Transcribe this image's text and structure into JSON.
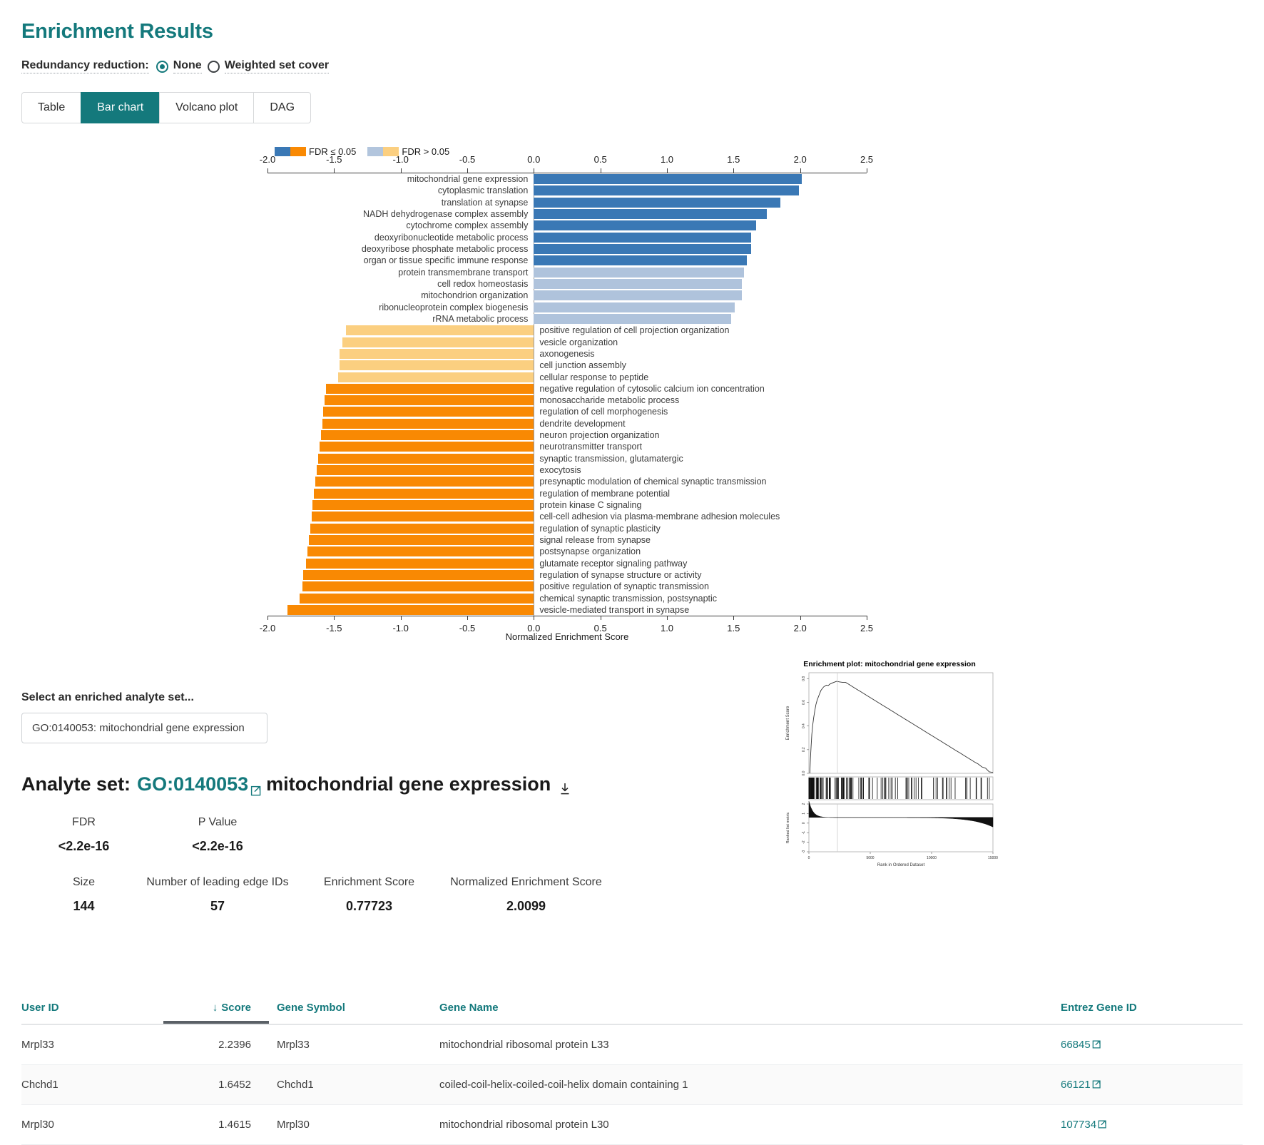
{
  "header": {
    "title": "Enrichment Results"
  },
  "redundancy": {
    "label": "Redundancy reduction:",
    "options": [
      {
        "label": "None",
        "selected": true
      },
      {
        "label": "Weighted set cover",
        "selected": false
      }
    ]
  },
  "tabs": [
    {
      "label": "Table",
      "active": false
    },
    {
      "label": "Bar chart",
      "active": true
    },
    {
      "label": "Volcano plot",
      "active": false
    },
    {
      "label": "DAG",
      "active": false
    }
  ],
  "chart_data": {
    "type": "bar",
    "orientation": "horizontal",
    "title": "",
    "xlabel": "Normalized Enrichment Score",
    "ylabel": "",
    "xlim": [
      -2.0,
      2.5
    ],
    "xticks": [
      -2.0,
      -1.5,
      -1.0,
      -0.5,
      0.0,
      0.5,
      1.0,
      1.5,
      2.0,
      2.5
    ],
    "xticklabels": [
      "-2.0",
      "-1.5",
      "-1.0",
      "-0.5",
      "0.0",
      "0.5",
      "1.0",
      "1.5",
      "2.0",
      "2.5"
    ],
    "grid": false,
    "legend": {
      "position": "top-left",
      "entries": [
        {
          "label": "FDR ≤ 0.05",
          "colors": [
            "#3a78b5",
            "#f98903"
          ]
        },
        {
          "label": "FDR > 0.05",
          "colors": [
            "#b2c5dd",
            "#fbcf80"
          ]
        }
      ]
    },
    "colors": {
      "pos_sig": "#3a78b5",
      "pos_nonsig": "#afc3dc",
      "neg_sig": "#f98903",
      "neg_nonsig": "#fbcf80"
    },
    "categories": [
      "mitochondrial gene expression",
      "cytoplasmic translation",
      "translation at synapse",
      "NADH dehydrogenase complex assembly",
      "cytochrome complex assembly",
      "deoxyribonucleotide metabolic process",
      "deoxyribose phosphate metabolic process",
      "organ or tissue specific immune response",
      "protein transmembrane transport",
      "cell redox homeostasis",
      "mitochondrion organization",
      "ribonucleoprotein complex biogenesis",
      "rRNA metabolic process",
      "positive regulation of cell projection organization",
      "vesicle organization",
      "axonogenesis",
      "cell junction assembly",
      "cellular response to peptide",
      "negative regulation of cytosolic calcium ion concentration",
      "monosaccharide metabolic process",
      "regulation of cell morphogenesis",
      "dendrite development",
      "neuron projection organization",
      "neurotransmitter transport",
      "synaptic transmission, glutamatergic",
      "exocytosis",
      "presynaptic modulation of chemical synaptic transmission",
      "regulation of membrane potential",
      "protein kinase C signaling",
      "cell-cell adhesion via plasma-membrane adhesion molecules",
      "regulation of synaptic plasticity",
      "signal release from synapse",
      "postsynapse organization",
      "glutamate receptor signaling pathway",
      "regulation of synapse structure or activity",
      "positive regulation of synaptic transmission",
      "chemical synaptic transmission, postsynaptic",
      "vesicle-mediated transport in synapse"
    ],
    "values": [
      2.01,
      1.99,
      1.85,
      1.75,
      1.67,
      1.63,
      1.63,
      1.6,
      1.58,
      1.56,
      1.56,
      1.51,
      1.48,
      -1.41,
      -1.44,
      -1.46,
      -1.46,
      -1.47,
      -1.56,
      -1.57,
      -1.58,
      -1.59,
      -1.6,
      -1.61,
      -1.62,
      -1.63,
      -1.64,
      -1.65,
      -1.66,
      -1.67,
      -1.68,
      -1.69,
      -1.7,
      -1.71,
      -1.73,
      -1.74,
      -1.76,
      -1.85
    ],
    "significant": [
      true,
      true,
      true,
      true,
      true,
      true,
      true,
      true,
      false,
      false,
      false,
      false,
      false,
      false,
      false,
      false,
      false,
      false,
      true,
      true,
      true,
      true,
      true,
      true,
      true,
      true,
      true,
      true,
      true,
      true,
      true,
      true,
      true,
      true,
      true,
      true,
      true,
      true
    ]
  },
  "selector": {
    "label": "Select an enriched analyte set...",
    "value": "GO:0140053: mitochondrial gene expression"
  },
  "analyte": {
    "prefix": "Analyte set:",
    "id": "GO:0140053",
    "name": "mitochondrial gene expression",
    "external_link_icon": "external-link-icon",
    "download_icon": "download-icon"
  },
  "stats": {
    "row1": [
      {
        "key": "FDR",
        "value": "<2.2e-16"
      },
      {
        "key": "P Value",
        "value": "<2.2e-16"
      }
    ],
    "row2": [
      {
        "key": "Size",
        "value": "144"
      },
      {
        "key": "Number of leading edge IDs",
        "value": "57"
      },
      {
        "key": "Enrichment Score",
        "value": "0.77723"
      },
      {
        "key": "Normalized Enrichment Score",
        "value": "2.0099"
      }
    ]
  },
  "gsea_plot": {
    "title": "Enrichment plot: mitochondrial gene expression",
    "ylabel_top": "Enrichment Score",
    "ylabel_bottom": "Ranked list metric",
    "xlabel": "Rank in Ordered Dataset",
    "yticks_top": [
      "0.0",
      "0.2",
      "0.4",
      "0.6",
      "0.8"
    ],
    "yticks_bottom": [
      "-3",
      "-2",
      "-1",
      "0",
      "1",
      "2"
    ],
    "xticks": [
      "0",
      "5000",
      "10000",
      "15000"
    ]
  },
  "table": {
    "columns": [
      "User ID",
      "Score",
      "Gene Symbol",
      "Gene Name",
      "Entrez Gene ID"
    ],
    "sort": {
      "column": "Score",
      "direction": "desc",
      "indicator": "↓"
    },
    "rows": [
      {
        "user_id": "Mrpl33",
        "score": "2.2396",
        "gene_symbol": "Mrpl33",
        "gene_name": "mitochondrial ribosomal protein L33",
        "entrez": "66845"
      },
      {
        "user_id": "Chchd1",
        "score": "1.6452",
        "gene_symbol": "Chchd1",
        "gene_name": "coiled-coil-helix-coiled-coil-helix domain containing 1",
        "entrez": "66121"
      },
      {
        "user_id": "Mrpl30",
        "score": "1.4615",
        "gene_symbol": "Mrpl30",
        "gene_name": "mitochondrial ribosomal protein L30",
        "entrez": "107734"
      }
    ]
  }
}
